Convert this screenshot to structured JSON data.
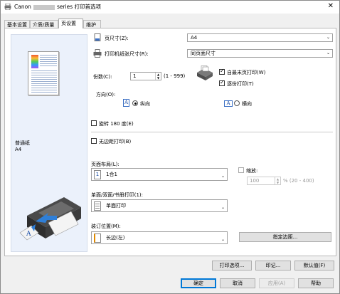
{
  "window": {
    "title_prefix": "Canon",
    "title_suffix": "series 打印首选项",
    "close": "✕"
  },
  "tabs": [
    {
      "label": "基本设置"
    },
    {
      "label": "介质/质量"
    },
    {
      "label": "页设置"
    },
    {
      "label": "维护"
    }
  ],
  "preview": {
    "media_type": "普通纸",
    "paper_size": "A4"
  },
  "page_setup": {
    "page_size_label": "页尺寸(Z):",
    "page_size_value": "A4",
    "output_size_label": "打印机纸张尺寸(R):",
    "output_size_value": "同页面尺寸",
    "copies_label": "份数(C):",
    "copies_value": "1",
    "copies_range": "(1 - 999)",
    "last_page_first_label": "自最末页打印(W)",
    "last_page_first_checked": true,
    "collate_label": "逐份打印(T)",
    "collate_checked": true,
    "orientation_label": "方向(O):",
    "portrait_label": "纵向",
    "landscape_label": "横向",
    "orientation_selected": "portrait",
    "rotate_label": "旋转 180 度(E)",
    "rotate_checked": false,
    "borderless_label": "无边距打印(B)",
    "borderless_checked": false,
    "layout_label": "页面布局(L):",
    "layout_value": "1合1",
    "scale_label": "缩放:",
    "scale_checked": false,
    "scale_value": "100",
    "scale_range": "% (20 - 400)",
    "duplex_label": "单面/双面/书册打印(1):",
    "duplex_value": "单面打印",
    "stapling_label": "装订位置(M):",
    "stapling_value": "长边(左)",
    "margin_button": "指定边距..."
  },
  "footer_buttons": {
    "print_options": "打印选项...",
    "stamp": "印记...",
    "defaults": "默认值(F)"
  },
  "dialog_buttons": {
    "ok": "确定",
    "cancel": "取消",
    "apply": "应用(A)",
    "help": "帮助"
  },
  "colors": {
    "preview_bg": "#ebf1fb",
    "accent": "#0078d7"
  },
  "icons": [
    "printer-icon",
    "close-icon",
    "page-size-icon",
    "output-size-icon",
    "collate-icon",
    "portrait-icon",
    "landscape-icon",
    "layout-1on1-icon",
    "single-side-icon",
    "stapling-icon",
    "dropdown-arrow-icon"
  ]
}
